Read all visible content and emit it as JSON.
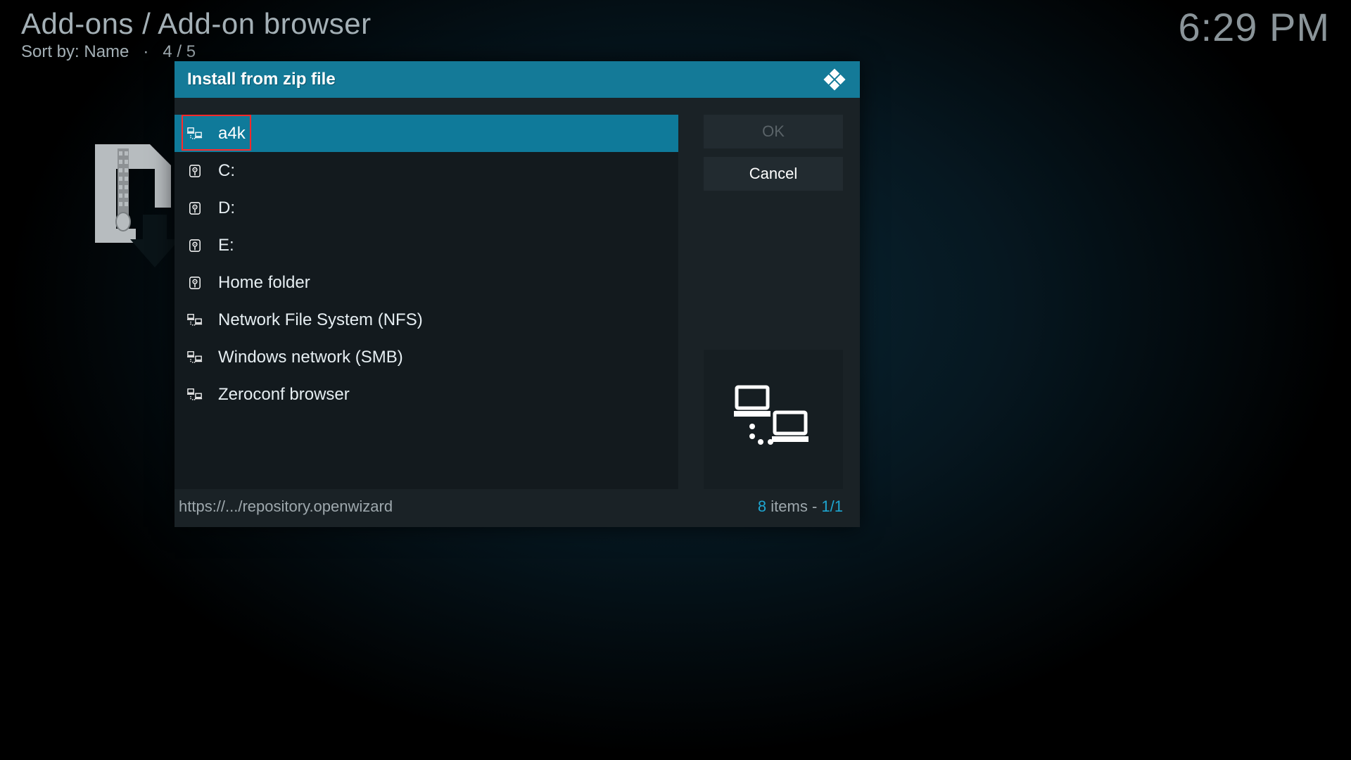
{
  "header": {
    "breadcrumb": "Add-ons / Add-on browser",
    "sort_label": "Sort by: Name",
    "position": "4 / 5",
    "clock": "6:29 PM"
  },
  "dialog": {
    "title": "Install from zip file",
    "ok_label": "OK",
    "cancel_label": "Cancel",
    "items": [
      {
        "label": "a4k",
        "icon": "network",
        "selected": true
      },
      {
        "label": "C:",
        "icon": "drive",
        "selected": false
      },
      {
        "label": "D:",
        "icon": "drive",
        "selected": false
      },
      {
        "label": "E:",
        "icon": "drive",
        "selected": false
      },
      {
        "label": "Home folder",
        "icon": "drive",
        "selected": false
      },
      {
        "label": "Network File System (NFS)",
        "icon": "network",
        "selected": false
      },
      {
        "label": "Windows network (SMB)",
        "icon": "network",
        "selected": false
      },
      {
        "label": "Zeroconf browser",
        "icon": "network",
        "selected": false
      }
    ],
    "footer_path": "https://.../repository.openwizard",
    "footer_count": "8",
    "footer_items_word": " items - ",
    "footer_page": "1/1"
  }
}
